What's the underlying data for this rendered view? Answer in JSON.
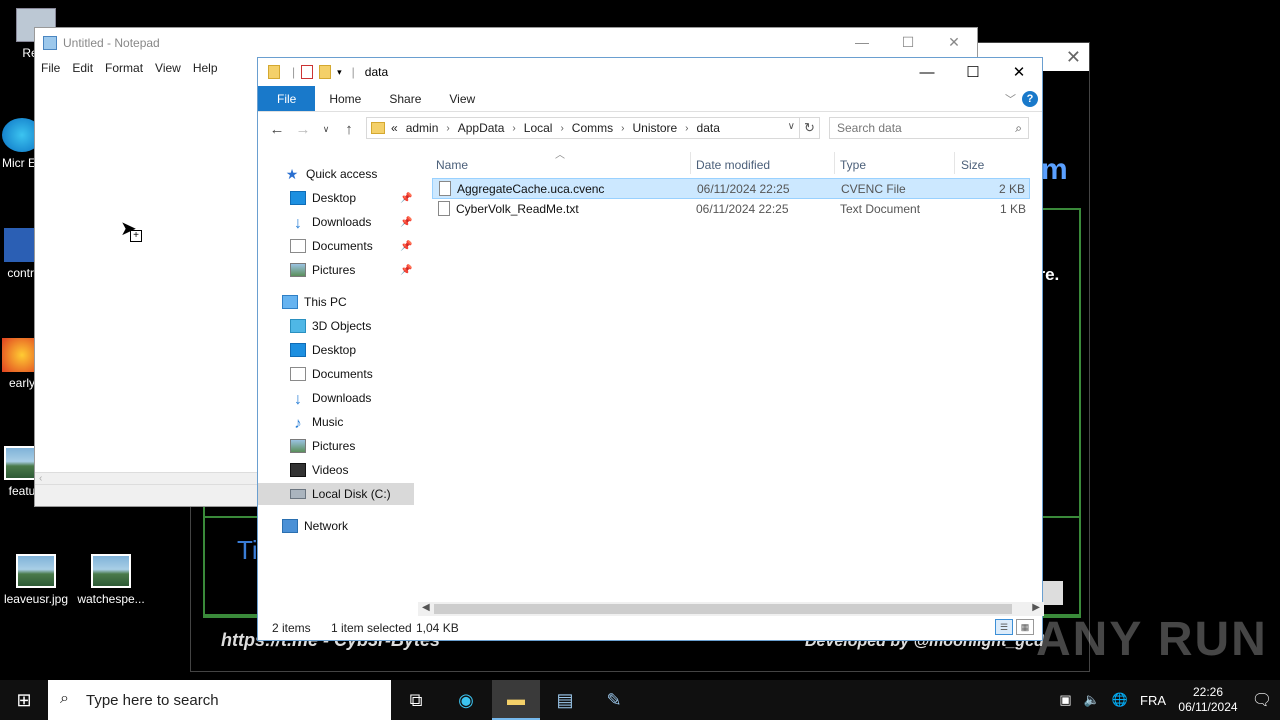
{
  "desktop": {
    "icons": [
      {
        "label": "Recy"
      },
      {
        "label": "Micr Ec"
      },
      {
        "label": "contra"
      },
      {
        "label": "early"
      },
      {
        "label": "featur"
      },
      {
        "label": "leaveusr.jpg"
      },
      {
        "label": "watchespe..."
      }
    ]
  },
  "ransom": {
    "partial_text_1": "m",
    "partial_text_2": "are.",
    "partial_text_3": "Ti",
    "footer_left": "https://t.me - Cyb3r-Bytes",
    "footer_right": "Developed by @moonlight_gcd"
  },
  "notepad": {
    "title": "Untitled - Notepad",
    "menu": [
      "File",
      "Edit",
      "Format",
      "View",
      "Help"
    ]
  },
  "explorer": {
    "title": "data",
    "ribbon_tabs": [
      "File",
      "Home",
      "Share",
      "View"
    ],
    "breadcrumb": [
      "admin",
      "AppData",
      "Local",
      "Comms",
      "Unistore",
      "data"
    ],
    "breadcrumb_prefix": "«",
    "search_placeholder": "Search data",
    "nav": {
      "quick_access": "Quick access",
      "qa_items": [
        "Desktop",
        "Downloads",
        "Documents",
        "Pictures"
      ],
      "this_pc": "This PC",
      "pc_items": [
        "3D Objects",
        "Desktop",
        "Documents",
        "Downloads",
        "Music",
        "Pictures",
        "Videos",
        "Local Disk (C:)"
      ],
      "network": "Network"
    },
    "columns": {
      "name": "Name",
      "date": "Date modified",
      "type": "Type",
      "size": "Size"
    },
    "files": [
      {
        "name": "AggregateCache.uca.cvenc",
        "date": "06/11/2024 22:25",
        "type": "CVENC File",
        "size": "2 KB"
      },
      {
        "name": "CyberVolk_ReadMe.txt",
        "date": "06/11/2024 22:25",
        "type": "Text Document",
        "size": "1 KB"
      }
    ],
    "status": {
      "count": "2 items",
      "selected": "1 item selected",
      "size": "1,04 KB"
    }
  },
  "watermark": "ANY RUN",
  "taskbar": {
    "search_placeholder": "Type here to search",
    "language": "FRA",
    "time": "22:26",
    "date": "06/11/2024"
  }
}
